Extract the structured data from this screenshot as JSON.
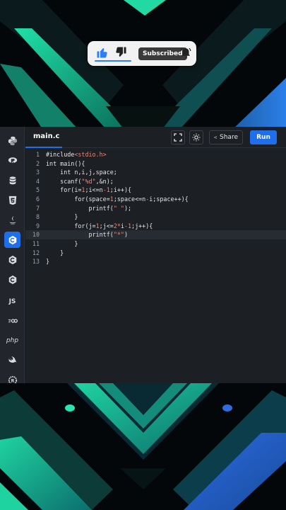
{
  "overlay": {
    "subscribe_label": "Subscribed",
    "icons": [
      "thumbs-up-icon",
      "thumbs-down-icon",
      "bell-icon"
    ]
  },
  "sidebar": {
    "languages": [
      "python",
      "r",
      "sql",
      "html",
      "java",
      "c",
      "cpp",
      "csharp",
      "javascript",
      "go",
      "php",
      "swift",
      "rust"
    ],
    "active": "c",
    "labels": {
      "javascript": "JS",
      "php": "php"
    }
  },
  "editor": {
    "tab": "main.c",
    "share_label": "Share",
    "run_label": "Run",
    "current_line": 10,
    "line_numbers": [
      "1",
      "2",
      "3",
      "4",
      "5",
      "6",
      "7",
      "8",
      "9",
      "10",
      "11",
      "12",
      "13"
    ]
  },
  "code": [
    [
      [
        "pre",
        "#include"
      ],
      [
        "str",
        "<stdio.h>"
      ]
    ],
    [
      [
        "kw",
        "int main(){"
      ]
    ],
    [
      [
        "kw",
        "    int n,i,j,space;"
      ]
    ],
    [
      [
        "kw",
        "    scanf("
      ],
      [
        "str",
        "\"%d\""
      ],
      [
        "kw",
        ",&n);"
      ]
    ],
    [
      [
        "kw",
        "    for(i="
      ],
      [
        "num",
        "1"
      ],
      [
        "kw",
        ";i<=n"
      ],
      [
        "op",
        "-1"
      ],
      [
        "kw",
        ";i++){"
      ]
    ],
    [
      [
        "kw",
        "        for(space="
      ],
      [
        "num",
        "1"
      ],
      [
        "kw",
        ";space<=n"
      ],
      [
        "op",
        "-"
      ],
      [
        "kw",
        "i;space++){"
      ]
    ],
    [
      [
        "kw",
        "            printf("
      ],
      [
        "str",
        "\" \""
      ],
      [
        "kw",
        ");"
      ]
    ],
    [
      [
        "kw",
        "        }"
      ]
    ],
    [
      [
        "kw",
        "        for(j="
      ],
      [
        "num",
        "1"
      ],
      [
        "kw",
        ";j<="
      ],
      [
        "num",
        "2"
      ],
      [
        "op",
        "*"
      ],
      [
        "kw",
        "i"
      ],
      [
        "op",
        "-1"
      ],
      [
        "kw",
        ";j++){"
      ]
    ],
    [
      [
        "kw",
        "            printf("
      ],
      [
        "str",
        "\"*\""
      ],
      [
        "kw",
        ")"
      ]
    ],
    [
      [
        "kw",
        "        }"
      ]
    ],
    [
      [
        "kw",
        "    }"
      ]
    ],
    [
      [
        "kw",
        "}"
      ]
    ]
  ],
  "colors": {
    "accent": "#1f6feb",
    "editor_bg": "#1c1f24",
    "string": "#e68a7a",
    "background_teal": "#1fd3a0",
    "background_blue": "#2f6ce0"
  }
}
